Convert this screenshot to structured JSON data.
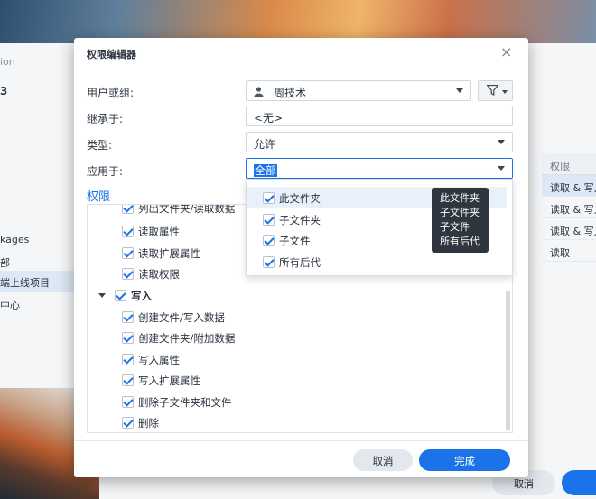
{
  "background": {
    "window_title_partial": "ion",
    "heading_partial": "3",
    "left_items": [
      "kages",
      "部",
      "端上线项目",
      "中心"
    ],
    "table_header": "权限",
    "table_rows": [
      "读取 & 写入",
      "读取 & 写入",
      "读取 & 写入",
      "读取"
    ],
    "cancel_label": "取消",
    "ok_label": ""
  },
  "dialog": {
    "title": "权限编辑器",
    "close_glyph": "×",
    "fields": {
      "user_label": "用户或组:",
      "user_value": "周技术",
      "inherit_label": "继承于:",
      "inherit_value": "<无>",
      "type_label": "类型:",
      "type_value": "允许",
      "apply_label": "应用于:",
      "apply_value": "全部"
    },
    "section_title": "权限",
    "permissions": [
      {
        "label": "列出文件夹/读取数据",
        "indent": 1
      },
      {
        "label": "读取属性",
        "indent": 1
      },
      {
        "label": "读取扩展属性",
        "indent": 1
      },
      {
        "label": "读取权限",
        "indent": 1
      },
      {
        "label": "写入",
        "indent": 0,
        "group": true
      },
      {
        "label": "创建文件/写入数据",
        "indent": 1
      },
      {
        "label": "创建文件夹/附加数据",
        "indent": 1
      },
      {
        "label": "写入属性",
        "indent": 1
      },
      {
        "label": "写入扩展属性",
        "indent": 1
      },
      {
        "label": "删除子文件夹和文件",
        "indent": 1
      },
      {
        "label": "删除",
        "indent": 1
      }
    ],
    "cancel_label": "取消",
    "done_label": "完成"
  },
  "apply_dropdown": {
    "options": [
      "此文件夹",
      "子文件夹",
      "子文件",
      "所有后代"
    ],
    "tooltip": [
      "此文件夹",
      "子文件夹",
      "子文件",
      "所有后代"
    ]
  },
  "colors": {
    "accent": "#1a73e8",
    "tooltip_bg": "#2f3640"
  }
}
